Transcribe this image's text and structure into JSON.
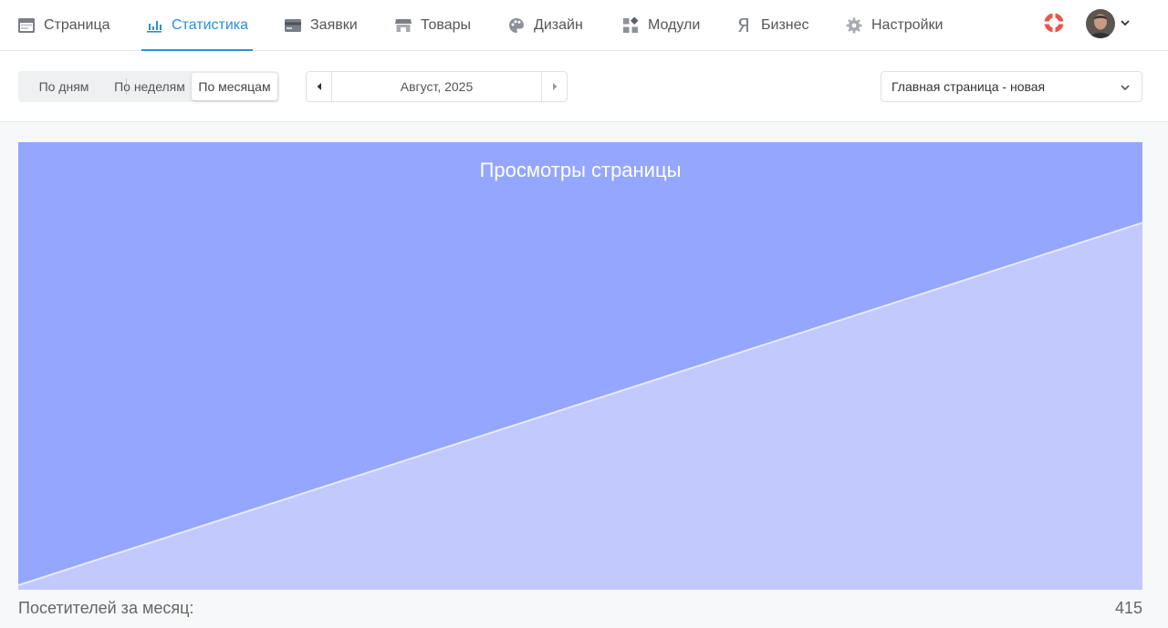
{
  "nav": {
    "items": [
      {
        "label": "Страница",
        "icon": "page-icon"
      },
      {
        "label": "Статистика",
        "icon": "stats-icon",
        "active": true
      },
      {
        "label": "Заявки",
        "icon": "card-icon"
      },
      {
        "label": "Товары",
        "icon": "store-icon"
      },
      {
        "label": "Дизайн",
        "icon": "palette-icon"
      },
      {
        "label": "Модули",
        "icon": "modules-icon"
      },
      {
        "label": "Бизнес",
        "icon": "yandex-icon"
      },
      {
        "label": "Настройки",
        "icon": "gear-icon"
      }
    ],
    "accent": "#2b8fd6"
  },
  "period": {
    "days": "По дням",
    "weeks": "По неделям",
    "months": "По месяцам",
    "selected": "months"
  },
  "date_nav": {
    "label": "Август, 2025"
  },
  "page_select": {
    "value": "Главная страница - новая"
  },
  "chart_data": {
    "type": "area",
    "title": "Просмотры страницы",
    "x": [
      0,
      1
    ],
    "values": [
      1,
      82
    ],
    "ylim": [
      0,
      100
    ],
    "grid": false,
    "colors": {
      "background": "#94a6fd",
      "fill": "#c1c9fd",
      "line": "#e6eaff"
    }
  },
  "footer": {
    "label": "Посетителей за месяц:",
    "value": "415"
  }
}
